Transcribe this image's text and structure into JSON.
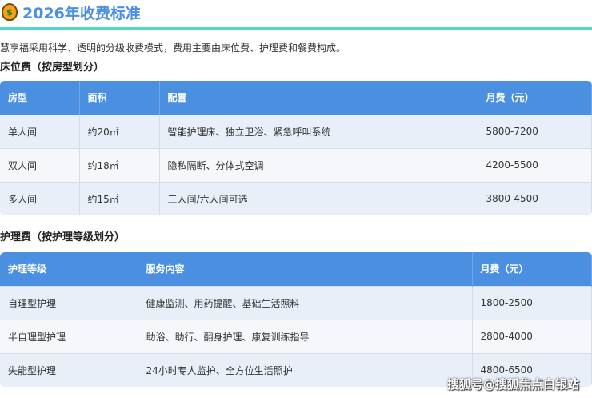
{
  "title": "2026年收费标准",
  "icon": "money-bag-icon",
  "intro": "慧享福采用科学、透明的分级收费模式，费用主要由床位费、护理费和餐费构成。",
  "bed": {
    "heading": "床位费（按房型划分）",
    "headers": [
      "房型",
      "面积",
      "配置",
      "月费（元）"
    ],
    "rows": [
      [
        "单人间",
        "约20㎡",
        "智能护理床、独立卫浴、紧急呼叫系统",
        "5800-7200"
      ],
      [
        "双人间",
        "约18㎡",
        "隐私隔断、分体式空调",
        "4200-5500"
      ],
      [
        "多人间",
        "约15㎡",
        "三人间/六人间可选",
        "3800-4500"
      ]
    ]
  },
  "care": {
    "heading": "护理费（按护理等级划分）",
    "headers": [
      "护理等级",
      "服务内容",
      "月费（元）"
    ],
    "rows": [
      [
        "自理型护理",
        "健康监测、用药提醒、基础生活照料",
        "1800-2500"
      ],
      [
        "半自理型护理",
        "助浴、助行、翻身护理、康复训练指导",
        "2800-4000"
      ],
      [
        "失能型护理",
        "24小时专人监护、全方位生活照护",
        "4800-6500"
      ]
    ]
  },
  "watermark": "搜狐号@搜狐焦点白银站"
}
